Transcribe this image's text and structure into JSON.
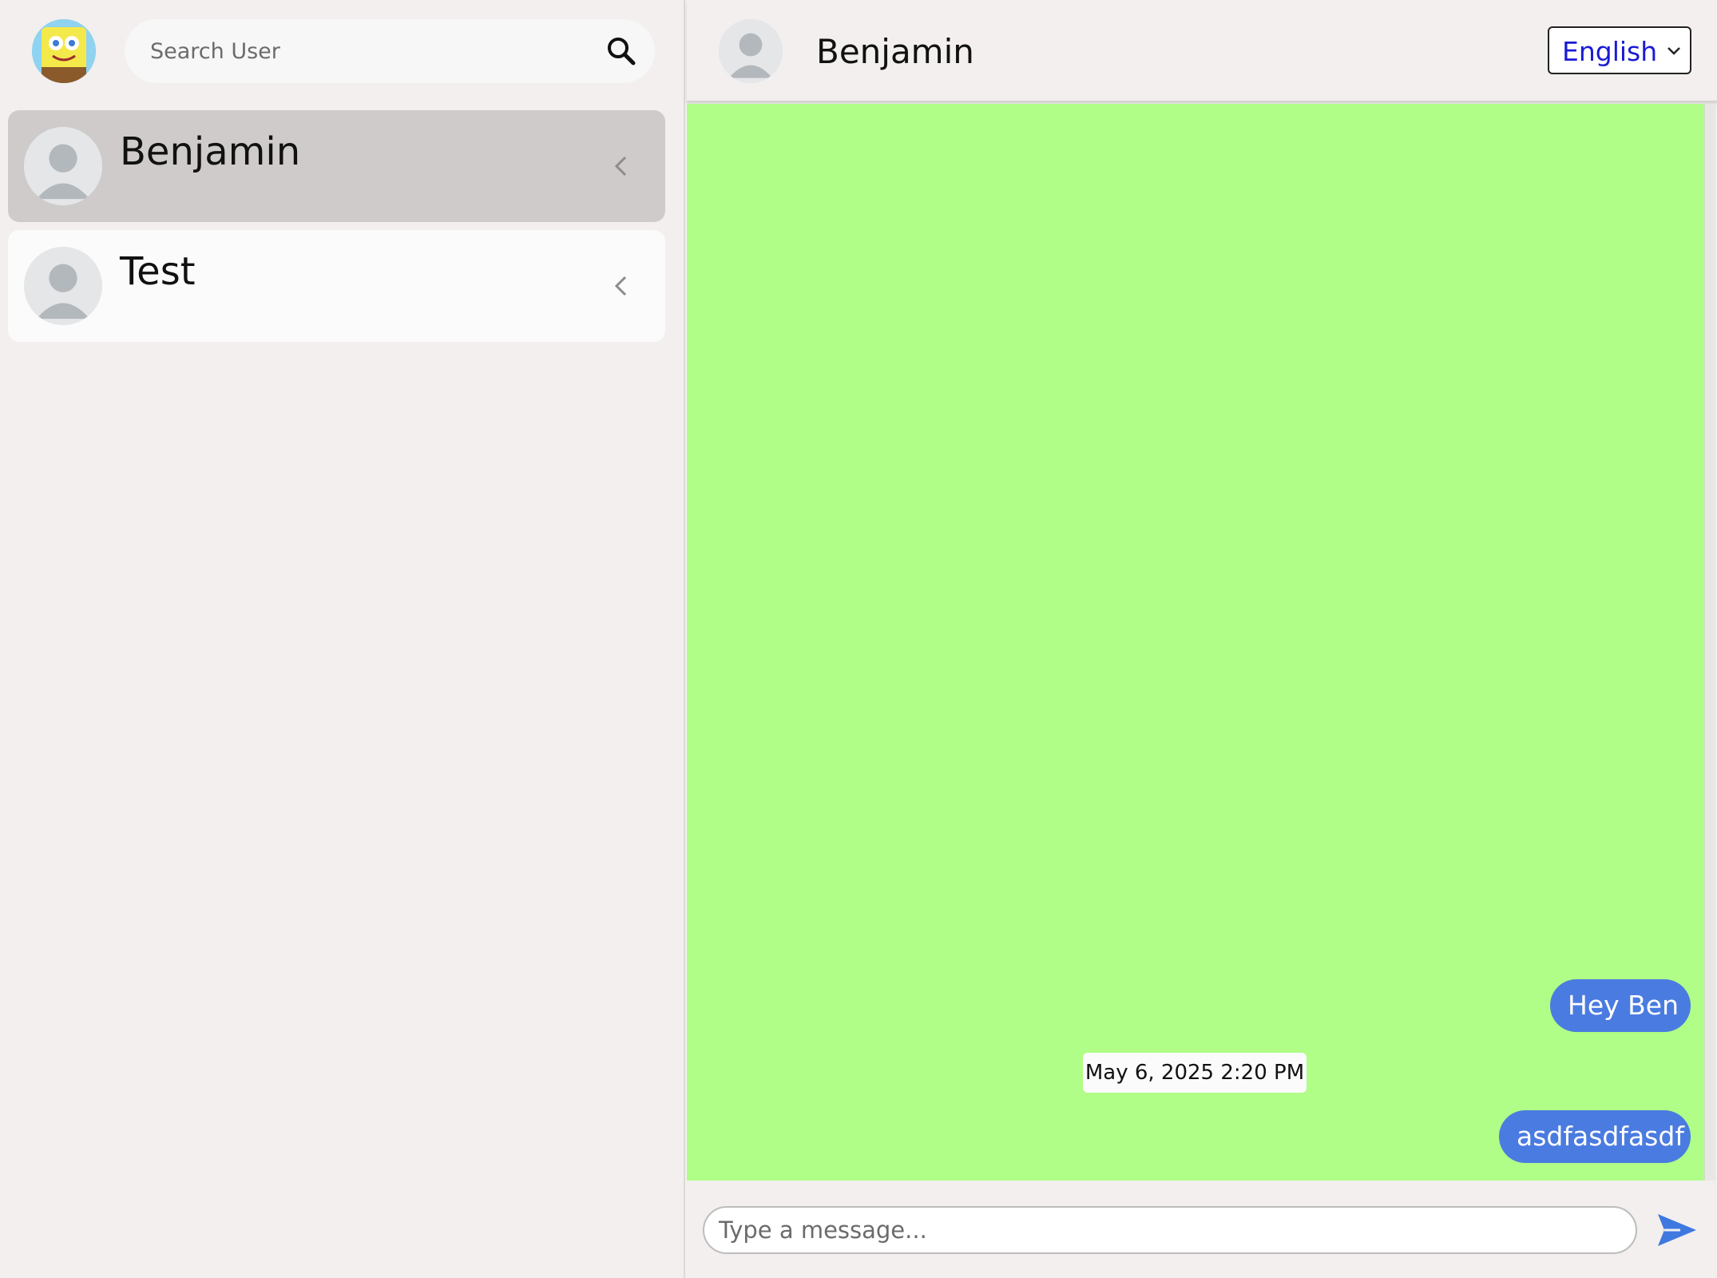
{
  "sidebar": {
    "search": {
      "placeholder": "Search User"
    },
    "contacts": [
      {
        "name": "Benjamin",
        "active": true
      },
      {
        "name": "Test",
        "active": false
      }
    ]
  },
  "chat": {
    "header": {
      "name": "Benjamin"
    },
    "language": {
      "selected": "English"
    },
    "messages": [
      {
        "text": "Hey Ben",
        "direction": "outgoing"
      },
      {
        "text": "asdfasdfasdf",
        "direction": "outgoing"
      }
    ],
    "timestamp": "May 6, 2025 2:20 PM",
    "composer": {
      "placeholder": "Type a message..."
    }
  },
  "colors": {
    "chat_background": "#b0fd87",
    "bubble": "#4a7be0",
    "active_contact": "#cfcbca",
    "language_text": "#1a1ad6"
  },
  "icons": [
    "user-profile-icon",
    "search-icon",
    "avatar-placeholder-icon",
    "chevron-left-icon",
    "chevron-down-icon",
    "send-icon"
  ]
}
